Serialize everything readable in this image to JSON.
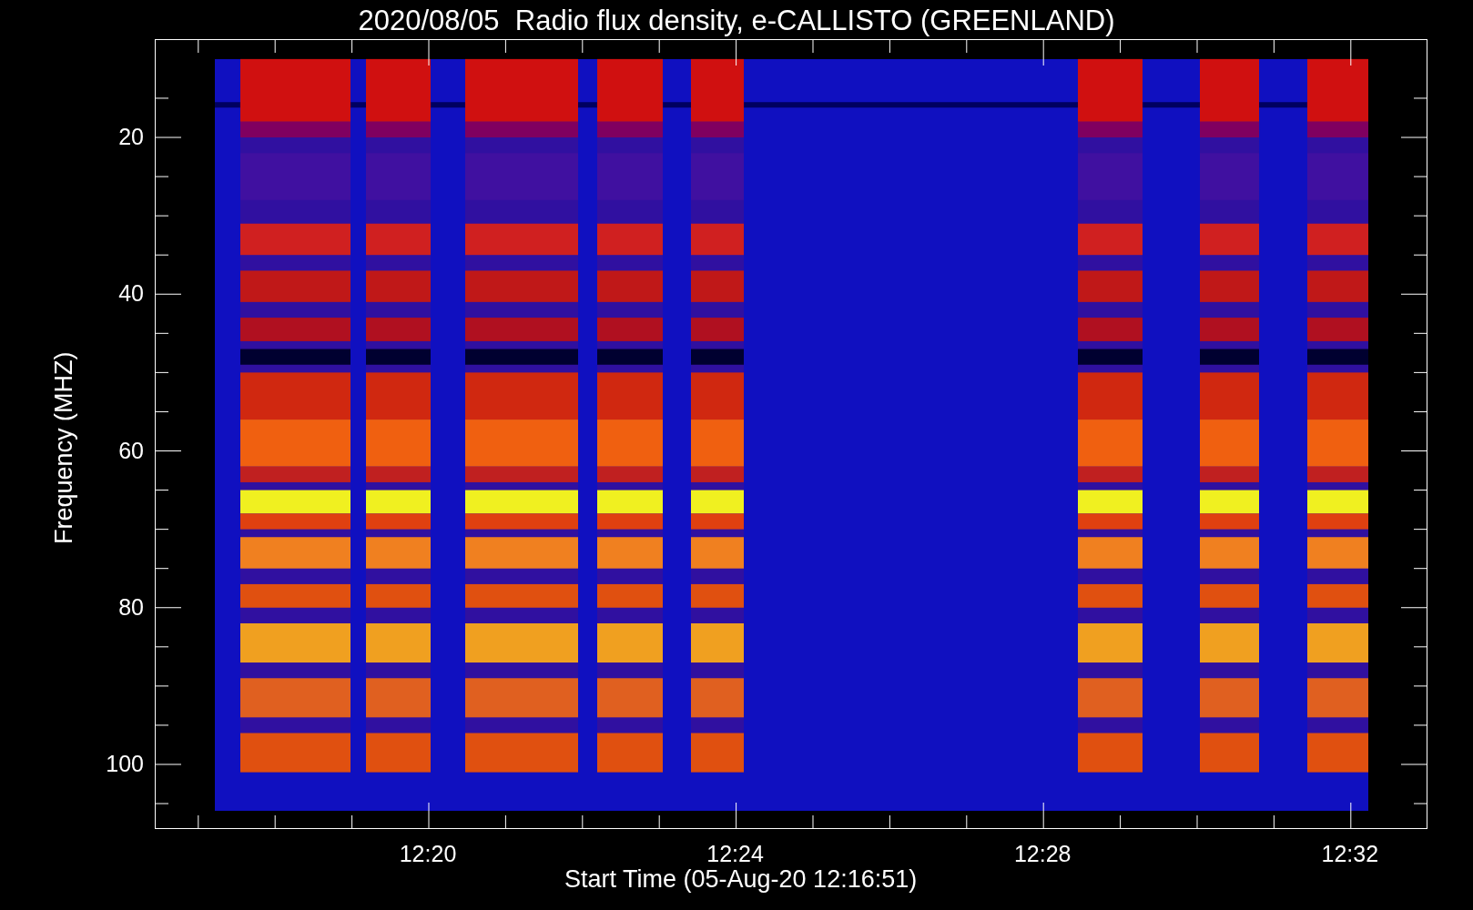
{
  "title": "2020/08/05  Radio flux density, e-CALLISTO (GREENLAND)",
  "y_axis": {
    "label": "Frequency (MHZ)",
    "ticks": [
      "20",
      "40",
      "60",
      "80",
      "100"
    ]
  },
  "x_axis": {
    "label": "Start Time (05-Aug-20 12:16:51)",
    "ticks": [
      "12:20",
      "12:24",
      "12:28",
      "12:32"
    ]
  }
}
